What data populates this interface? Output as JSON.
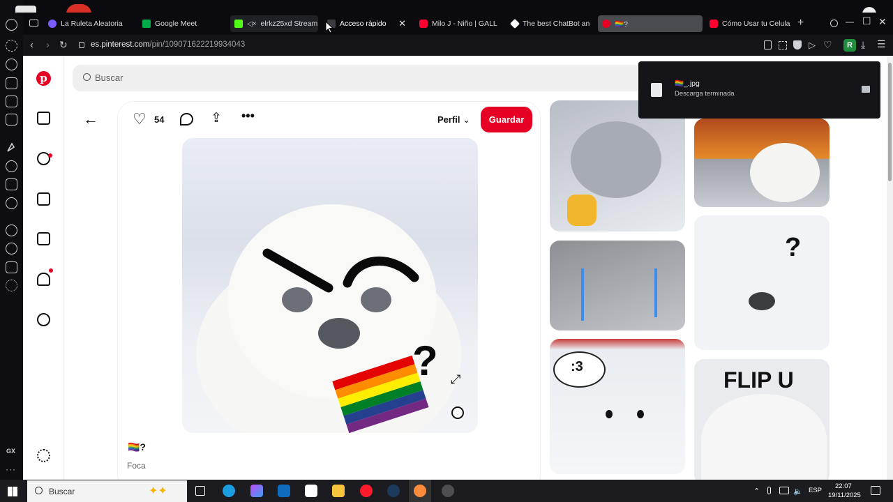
{
  "browser": {
    "tabs": [
      {
        "label": "La Ruleta Aleatoria",
        "favicon_color": "#7b5cff",
        "state": "normal"
      },
      {
        "label": "Google Meet",
        "favicon_color": "#00ac47",
        "state": "normal"
      },
      {
        "label": "elrkz25xd Stream",
        "favicon_color": "#53fc18",
        "state": "dim"
      },
      {
        "label": "Acceso rápido",
        "favicon_color": "#d9dbe0",
        "state": "active",
        "close": "✕"
      },
      {
        "label": "Milo J - Niño | GALL",
        "favicon_color": "#ff0033",
        "state": "normal"
      },
      {
        "label": "The best ChatBot an",
        "favicon_color": "#ffffff",
        "state": "normal"
      },
      {
        "label": "🏳️‍🌈?",
        "favicon_color": "#e60023",
        "state": "selected"
      },
      {
        "label": "Cómo Usar tu Celula",
        "favicon_color": "#ff0033",
        "state": "normal"
      }
    ],
    "new_tab": "+",
    "url_host": "es.pinterest.com",
    "url_path": "/pin/1090716222199340​43",
    "profile_initial": "R",
    "window_controls": {
      "minimize": "—",
      "maximize": "☐",
      "close": "✕"
    }
  },
  "pinterest": {
    "search_placeholder": "Buscar",
    "like_count": "54",
    "profile_select": "Perfil",
    "save_label": "Guardar",
    "pin_title": "🏳️‍🌈?",
    "pin_subtitle": "Foca",
    "thumbs": [
      {
        "caption": "",
        "variant": "laughing-seal"
      },
      {
        "caption": "",
        "variant": "explosion-seal"
      },
      {
        "caption": "",
        "variant": "crying-seal"
      },
      {
        "caption": "?",
        "variant": "question-seal"
      },
      {
        "caption": ":3",
        "variant": "waving-seal"
      },
      {
        "caption": "FLIP U",
        "variant": "flip-u-seal"
      }
    ]
  },
  "download": {
    "filename": "🏳️‍🌈_.jpg",
    "status": "Descarga terminada"
  },
  "rail": {
    "label": "GX",
    "more": "···"
  },
  "taskbar": {
    "search_label": "Buscar",
    "lang": "ESP",
    "time": "22:07",
    "date": "19/11/2025"
  },
  "colors": {
    "pinterest_red": "#e60023",
    "browser_bg": "#0b0b0f",
    "tab_selected": "#4a4b50"
  }
}
